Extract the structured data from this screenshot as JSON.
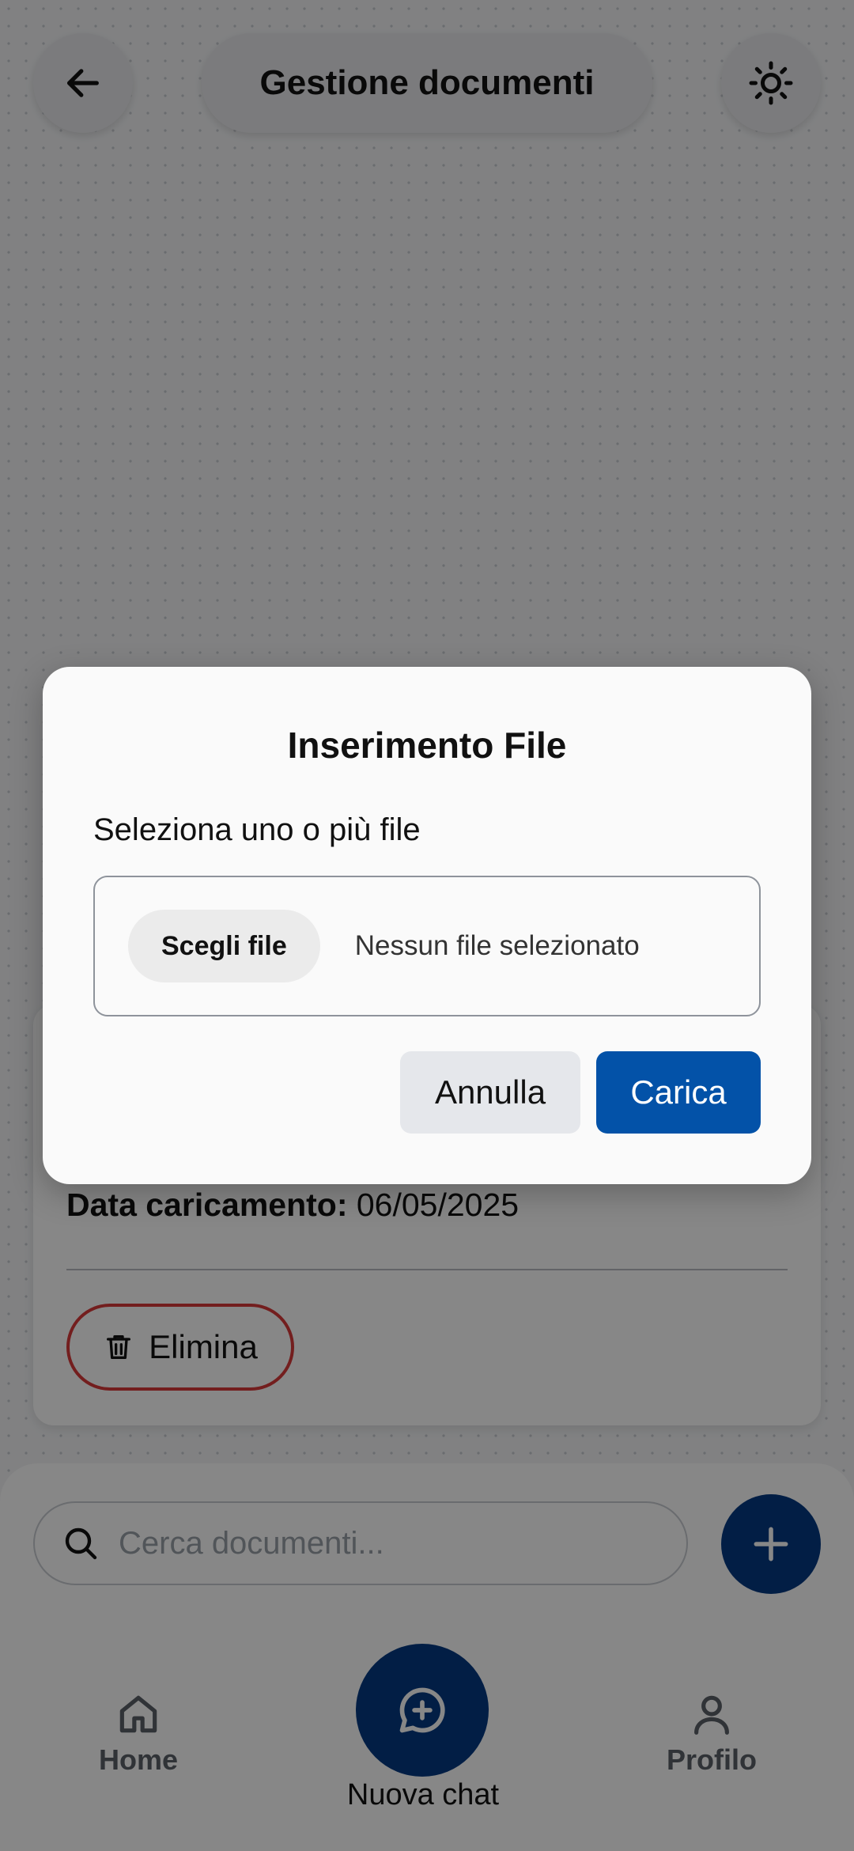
{
  "header": {
    "title": "Gestione documenti",
    "back_icon": "arrow-left-icon",
    "theme_icon": "sun-icon"
  },
  "document_card": {
    "date_label": "Data caricamento:",
    "date_value": "06/05/2025",
    "delete_label": "Elimina",
    "delete_icon": "trash-icon",
    "delete_color": "#d93a3a"
  },
  "search": {
    "placeholder": "Cerca documenti...",
    "value": ""
  },
  "bottom_nav": {
    "home_label": "Home",
    "new_chat_label": "Nuova chat",
    "profile_label": "Profilo"
  },
  "dialog": {
    "title": "Inserimento File",
    "label": "Seleziona uno o più file",
    "choose_button": "Scegli file",
    "no_file_text": "Nessun file selezionato",
    "cancel_button": "Annulla",
    "upload_button": "Carica"
  },
  "colors": {
    "primary": "#053a82",
    "upload_button": "#0352a8",
    "scrim": "rgba(0,0,0,0.47)"
  }
}
